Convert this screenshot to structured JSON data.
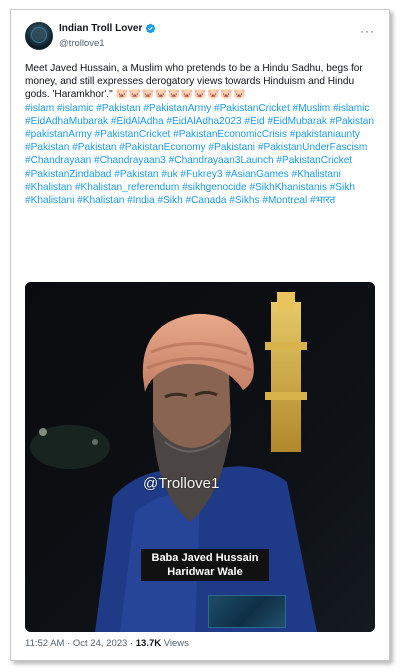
{
  "author": {
    "display_name": "Indian Troll Lover",
    "handle": "@trollove1"
  },
  "tweet": {
    "body": "Meet Javed Hussain, a Muslim who pretends to be a Hindu Sadhu, begs for money, and still expresses derogatory views towards Hinduism and Hindu gods. 'Haramkhor'.\"",
    "pig_emojis": "🐷🐷🐷🐷🐷🐷🐷🐷🐷🐷",
    "hashtags": "#islam #islamic #Pakistan #PakistanArmy #PakistanCricket #Muslim #islamic #EidAdhaMubarak #EidAlAdha #EidAlAdha2023 #Eid #EidMubarak #Pakistan #pakistanArmy #PakistanCricket #PakistanEconomicCrisis #pakistaniaunty #Pakistan #Pakistan #PakistanEconomy #Pakistani #PakistanUnderFascism #Chandrayaan #Chandrayaan3 #Chandrayaan3Launch #PakistanCricket #PakistanZindabad #Pakistan #uk #Fukrey3 #AsianGames #Khalistani #Khalistan #Khalistan_referendum #sikhgenocide #SikhKhanistanis #Sikh #Khalistani #Khalistan #India #Sikh #Canada #Sikhs #Montreal #भारत"
  },
  "media": {
    "watermark": "@Trollove1",
    "caption_line1": "Baba Javed Hussain",
    "caption_line2": "Haridwar Wale"
  },
  "footer": {
    "time": "11:52 AM",
    "separator": " · ",
    "date": "Oct 24, 2023",
    "views_count": "13.7K",
    "views_label": "Views"
  },
  "colors": {
    "link": "#1d9bf0",
    "verified": "#1d9bf0",
    "text": "#0f1419",
    "muted": "#536471"
  },
  "icons": [
    "verified-badge-icon",
    "more-options-icon"
  ]
}
